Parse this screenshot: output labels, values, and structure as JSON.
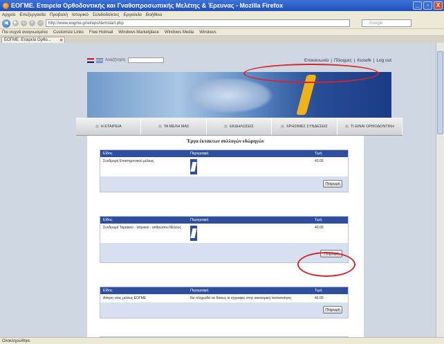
{
  "window": {
    "title": "ΕΟΓΜΕ. Εταιρεία Ορθοδοντικής και Γναθοπροσωπικής Μελέτης & Έρευνας - Mozilla Firefox",
    "buttons": [
      "_",
      "▫",
      "X"
    ]
  },
  "menubar": {
    "items": [
      "Αρχείο",
      "Επεξεργασία",
      "Προβολή",
      "Ιστορικό",
      "Σελιδοδείκτες",
      "Εργαλεία",
      "Βοήθεια"
    ]
  },
  "navbar": {
    "back": "◀",
    "forward": "▶",
    "reload": "C",
    "stop": "✕",
    "home": "⌂",
    "url": "http://www.eogme.gr/el/eps/itemstart.php",
    "search_placeholder": "Google"
  },
  "bookmarks": {
    "items": [
      "Πιο συχνά αναγνωσμένα",
      "Customize Links",
      "Free Hotmail",
      "Windows Marketplace",
      "Windows Media",
      "Windows"
    ]
  },
  "tab": {
    "label": "ΕΟΓΜΕ. Εταιρεία Ορθο...",
    "close": "✕"
  },
  "site": {
    "search_label": "Αναζήτηση",
    "toplinks": [
      "Επικοινωνία",
      "|",
      "Πίλογμες",
      "|",
      "Καλαθι",
      "|",
      "Log out"
    ],
    "nav": [
      "Η ΕΤΑΙΡΕΙΑ",
      "ΤΑ ΜΕΛΗ ΜΑΣ",
      "ΕΚΔΗΛΩΣΕΙΣ",
      "ΧΡΗΣΙΜΕΣ ΣΥΝΔΕΣΕΙΣ",
      "ΤΙ ΕΙΝΑΙ ΟΡΘΟΔΟΝΤΙΚΗ"
    ],
    "heading": "Έργα έκτακτων συλλογών εδώρηγών",
    "order_headers": [
      "Είδος",
      "Περιγραφή",
      "Τιμή"
    ],
    "orders": [
      {
        "item": "Συνδρομή Επιστημονικού μέλους",
        "description": "",
        "price": "40.00",
        "button": "Πληρωμή"
      },
      {
        "item": "Συνδρομή Ταμιακού - Ιατρικού - ανθρώπου Μέλους",
        "description": "",
        "price": "40.00",
        "button": "Πληρωμή"
      },
      {
        "item": "Αίτηση νέας μέλους ΕΟΓΜΕ",
        "description": "Να πληρωθεί σε δόσεις οι εγγραφές στην οικονομική πιστοποίηση",
        "price": "40.00",
        "button": "Πληρωμή"
      }
    ]
  },
  "statusbar": {
    "text": "Ολοκληρώθηκε"
  },
  "colors": {
    "title_bar": "#1f4fbd",
    "header_row": "#2d4f9c",
    "annotation": "#d8232a"
  }
}
